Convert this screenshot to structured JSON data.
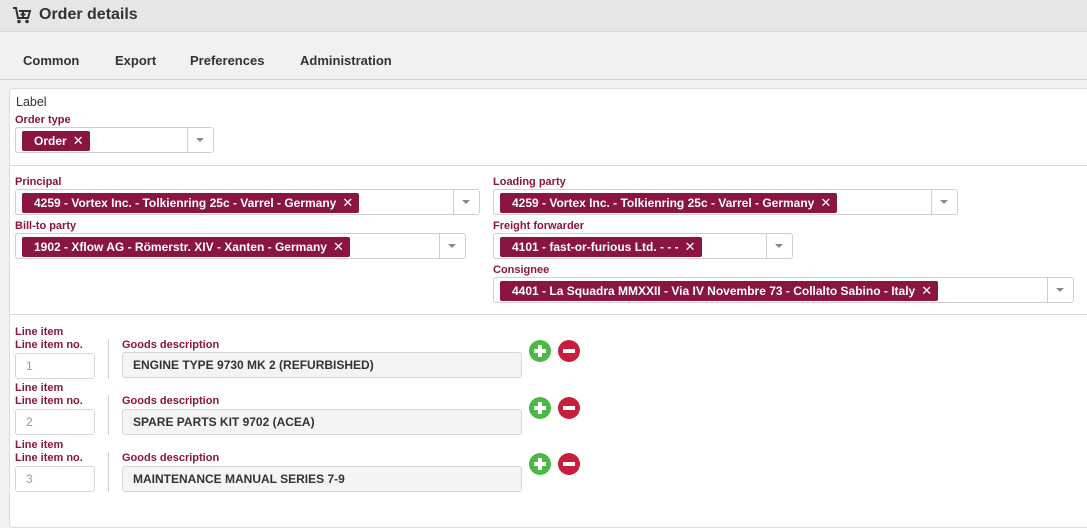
{
  "window": {
    "title": "Order details",
    "icon": "cart-icon"
  },
  "tabs": [
    {
      "label": "Common"
    },
    {
      "label": "Export"
    },
    {
      "label": "Preferences"
    },
    {
      "label": "Administration"
    }
  ],
  "label_section": {
    "heading": "Label"
  },
  "order_type": {
    "label": "Order type",
    "value": "Order"
  },
  "principal": {
    "label": "Principal",
    "value": "4259 - Vortex Inc. - Tolkienring 25c - Varrel - Germany"
  },
  "loading_party": {
    "label": "Loading party",
    "value": "4259 - Vortex Inc. - Tolkienring 25c - Varrel - Germany"
  },
  "bill_to_party": {
    "label": "Bill-to party",
    "value": "1902 - Xflow AG - Römerstr. XIV - Xanten - Germany"
  },
  "freight_forwarder": {
    "label": "Freight forwarder",
    "value": "4101 - fast-or-furious Ltd. - - -"
  },
  "consignee": {
    "label": "Consignee",
    "value": "4401 - La Squadra MMXXII - Via IV Novembre 73 - Collalto Sabino - Italy"
  },
  "line_items": [
    {
      "heading": "Line item",
      "no_label": "Line item no.",
      "no": "1",
      "desc_label": "Goods description",
      "desc": "ENGINE TYPE 9730 MK 2 (REFURBISHED)"
    },
    {
      "heading": "Line item",
      "no_label": "Line item no.",
      "no": "2",
      "desc_label": "Goods description",
      "desc": "SPARE PARTS KIT 9702 (ACEA)"
    },
    {
      "heading": "Line item",
      "no_label": "Line item no.",
      "no": "3",
      "desc_label": "Goods description",
      "desc": "MAINTENANCE MANUAL SERIES 7-9"
    }
  ],
  "chip_remove_glyph": "✕",
  "colors": {
    "accent": "#8a1540",
    "add": "#4cb944",
    "remove": "#c51f3d"
  }
}
